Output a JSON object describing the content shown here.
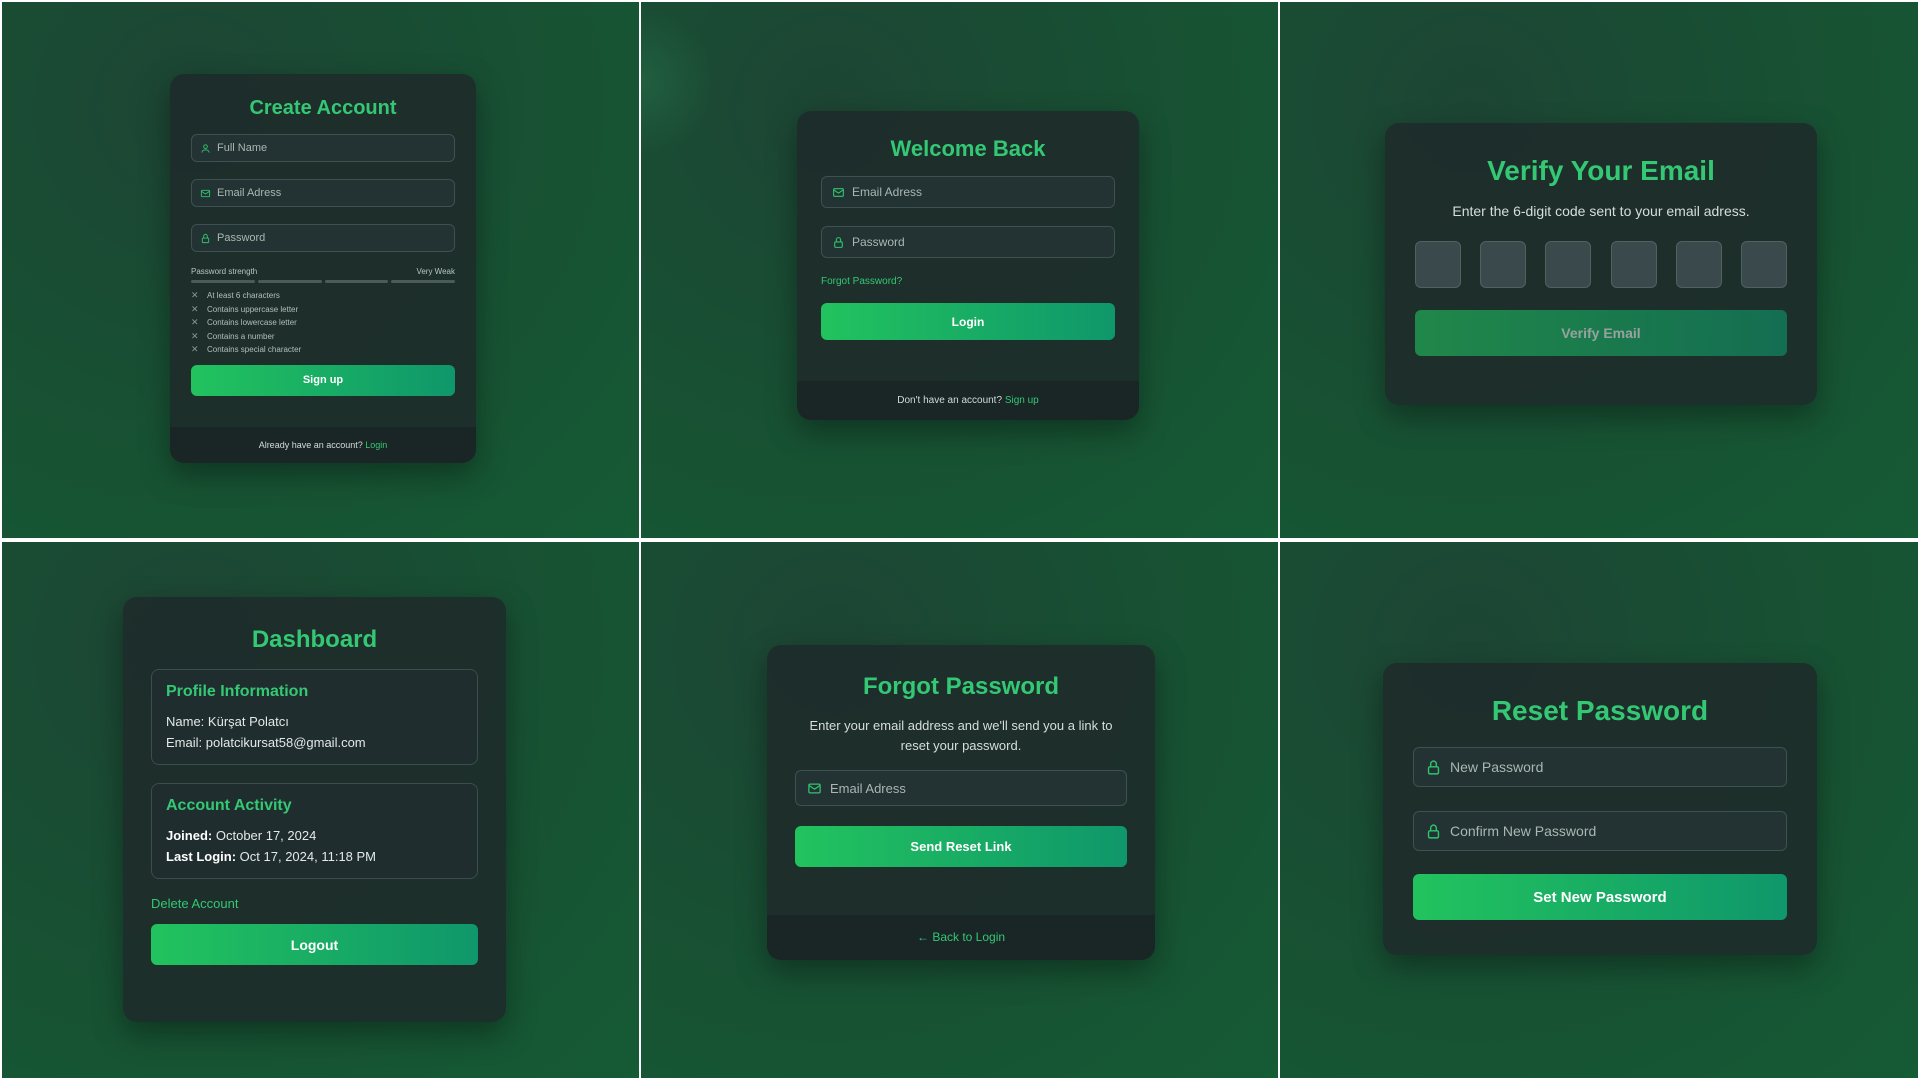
{
  "colors": {
    "accent": "#34c874",
    "card": "#1e2a2a",
    "button_start": "#22c35e",
    "button_end": "#0f976b"
  },
  "signup": {
    "title": "Create Account",
    "full_name_placeholder": "Full Name",
    "email_placeholder": "Email Adress",
    "password_placeholder": "Password",
    "strength_label": "Password strength",
    "strength_value": "Very Weak",
    "requirements": [
      "At least 6 characters",
      "Contains uppercase letter",
      "Contains lowercase letter",
      "Contains a number",
      "Contains special character"
    ],
    "submit_label": "Sign up",
    "footer_text": "Already have an account?",
    "footer_link": "Login"
  },
  "login": {
    "title": "Welcome Back",
    "email_placeholder": "Email Adress",
    "password_placeholder": "Password",
    "forgot_link": "Forgot Password?",
    "submit_label": "Login",
    "footer_text": "Don't have an account?",
    "footer_link": "Sign up"
  },
  "verify": {
    "title": "Verify Your Email",
    "subtitle": "Enter the 6-digit code sent to your email adress.",
    "submit_label": "Verify Email"
  },
  "dashboard": {
    "title": "Dashboard",
    "profile_heading": "Profile Information",
    "name_label": "Name:",
    "name_value": "Kürşat Polatcı",
    "email_label": "Email:",
    "email_value": "polatcikursat58@gmail.com",
    "activity_heading": "Account Activity",
    "joined_label": "Joined:",
    "joined_value": "October 17, 2024",
    "last_login_label": "Last Login:",
    "last_login_value": "Oct 17, 2024, 11:18 PM",
    "delete_label": "Delete Account",
    "logout_label": "Logout"
  },
  "forgot": {
    "title": "Forgot Password",
    "subtitle": "Enter your email address and we'll send you a link to reset your password.",
    "email_placeholder": "Email Adress",
    "submit_label": "Send Reset Link",
    "back_label": "Back to Login"
  },
  "reset": {
    "title": "Reset Password",
    "new_placeholder": "New Password",
    "confirm_placeholder": "Confirm New Password",
    "submit_label": "Set New Password"
  }
}
